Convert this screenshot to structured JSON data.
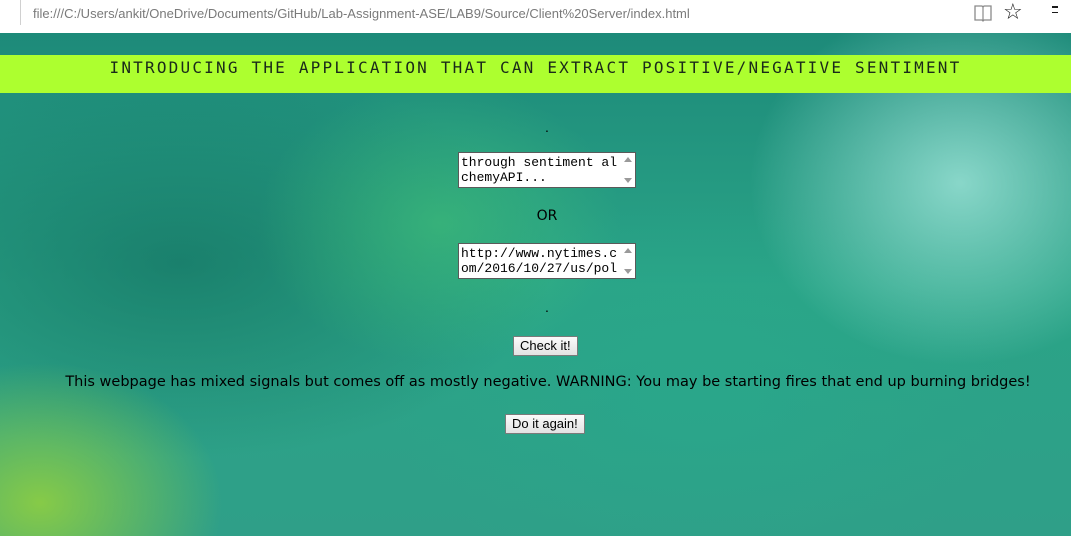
{
  "browser": {
    "url": "file:///C:/Users/ankit/OneDrive/Documents/GitHub/Lab-Assignment-ASE/LAB9/Source/Client%20Server/index.html",
    "favorite_icon": "star-icon",
    "reading_icon": "book-icon",
    "more_icon": "more-icon"
  },
  "header": {
    "title": "INTRODUCING THE APPLICATION THAT CAN EXTRACT POSITIVE/NEGATIVE SENTIMENT",
    "background": "#adff2f"
  },
  "form": {
    "dot_top": ".",
    "text_input_value": "through sentiment alchemyAPI...",
    "or_label": "OR",
    "url_input_value": "http://www.nytimes.com/2016/10/27/us/pol",
    "dot_bottom": ".",
    "check_button": "Check it!"
  },
  "result": {
    "message": "This webpage has mixed signals but comes off as mostly negative. WARNING: You may be starting fires that end up burning bridges!",
    "again_button": "Do it again!"
  }
}
